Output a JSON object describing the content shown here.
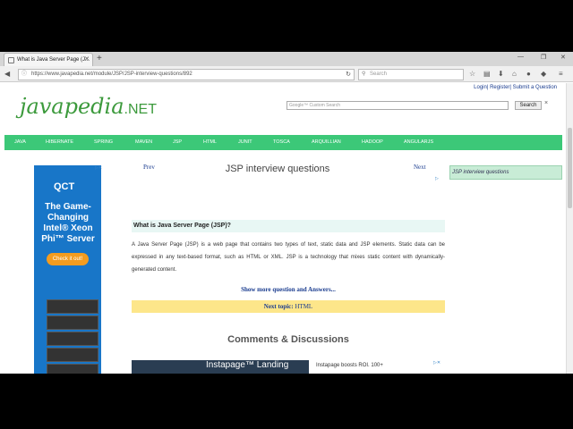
{
  "browser": {
    "tab_title": "What is Java Server Page (J...",
    "url": "https://www.javapedia.net/module/JSP/JSP-interview-questions/892",
    "search_placeholder": "Search"
  },
  "site": {
    "top_links": "Login| Register| Submit a Question",
    "logo_main": "javapedia",
    "logo_suffix": ".NET",
    "google_placeholder": "Google™ Custom Search",
    "search_button": "Search",
    "search_clear": "×",
    "menu": [
      "JAVA",
      "HIBERNATE",
      "SPRING",
      "MAVEN",
      "JSP",
      "HTML",
      "JUNIT",
      "TOSCA",
      "ARQUILLIAN",
      "HADOOP",
      "ANGULARJS"
    ]
  },
  "ad_left": {
    "brand": "QCT",
    "headline": "The Game-Changing Intel® Xeon Phi™ Server",
    "cta": "Check it out!"
  },
  "content": {
    "prev": "Prev",
    "next": "Next",
    "title": "JSP interview questions",
    "question": "What is Java Server Page (JSP)?",
    "answer": "A Java Server Page (JSP) is a web page that contains two types of text, static data and JSP elements. Static data can be expressed in any text-based format, such as HTML or XML. JSP is a technology that mixes static content with dynamically-generated content.",
    "show_more": "Show more question and Answers...",
    "next_topic_label": "Next topic:",
    "next_topic_value": "HTML",
    "comments_title": "Comments & Discussions"
  },
  "ad_bottom": {
    "headline": "Instapage™ Landing",
    "text": "Instapage boosts ROI. 100+"
  },
  "sidebar": {
    "box_title": "JSP interview questions"
  }
}
